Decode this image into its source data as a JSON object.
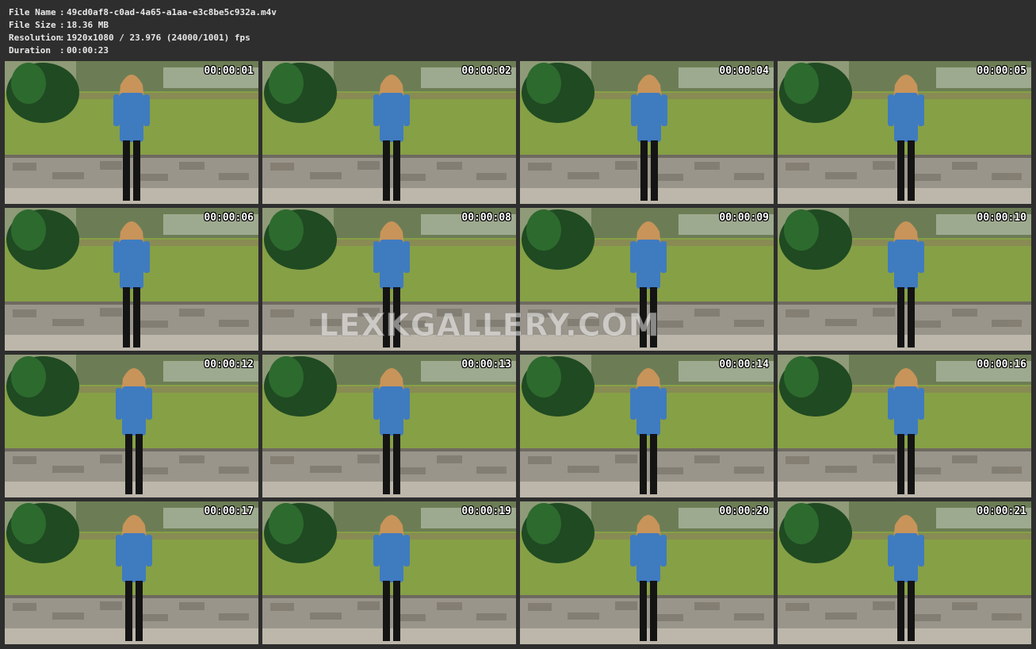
{
  "file_info": {
    "file_name_label": "File Name",
    "file_name": "49cd0af8-c0ad-4a65-a1aa-e3c8be5c932a.m4v",
    "file_size_label": "File Size",
    "file_size": "18.36 MB",
    "resolution_label": "Resolution",
    "resolution": "1920x1080 / 23.976 (24000/1001) fps",
    "duration_label": "Duration",
    "duration": "00:00:23",
    "separator": ":"
  },
  "thumbnails": [
    {
      "timestamp": "00:00:01"
    },
    {
      "timestamp": "00:00:02"
    },
    {
      "timestamp": "00:00:04"
    },
    {
      "timestamp": "00:00:05"
    },
    {
      "timestamp": "00:00:06"
    },
    {
      "timestamp": "00:00:08"
    },
    {
      "timestamp": "00:00:09"
    },
    {
      "timestamp": "00:00:10"
    },
    {
      "timestamp": "00:00:12"
    },
    {
      "timestamp": "00:00:13"
    },
    {
      "timestamp": "00:00:14"
    },
    {
      "timestamp": "00:00:16"
    },
    {
      "timestamp": "00:00:17"
    },
    {
      "timestamp": "00:00:19"
    },
    {
      "timestamp": "00:00:20"
    },
    {
      "timestamp": "00:00:21"
    }
  ],
  "watermark": "LEXKGALLERY.COM",
  "colors": {
    "background": "#2e2e2e",
    "header_text": "#e8e8e8",
    "timestamp_text": "#ffffff"
  }
}
